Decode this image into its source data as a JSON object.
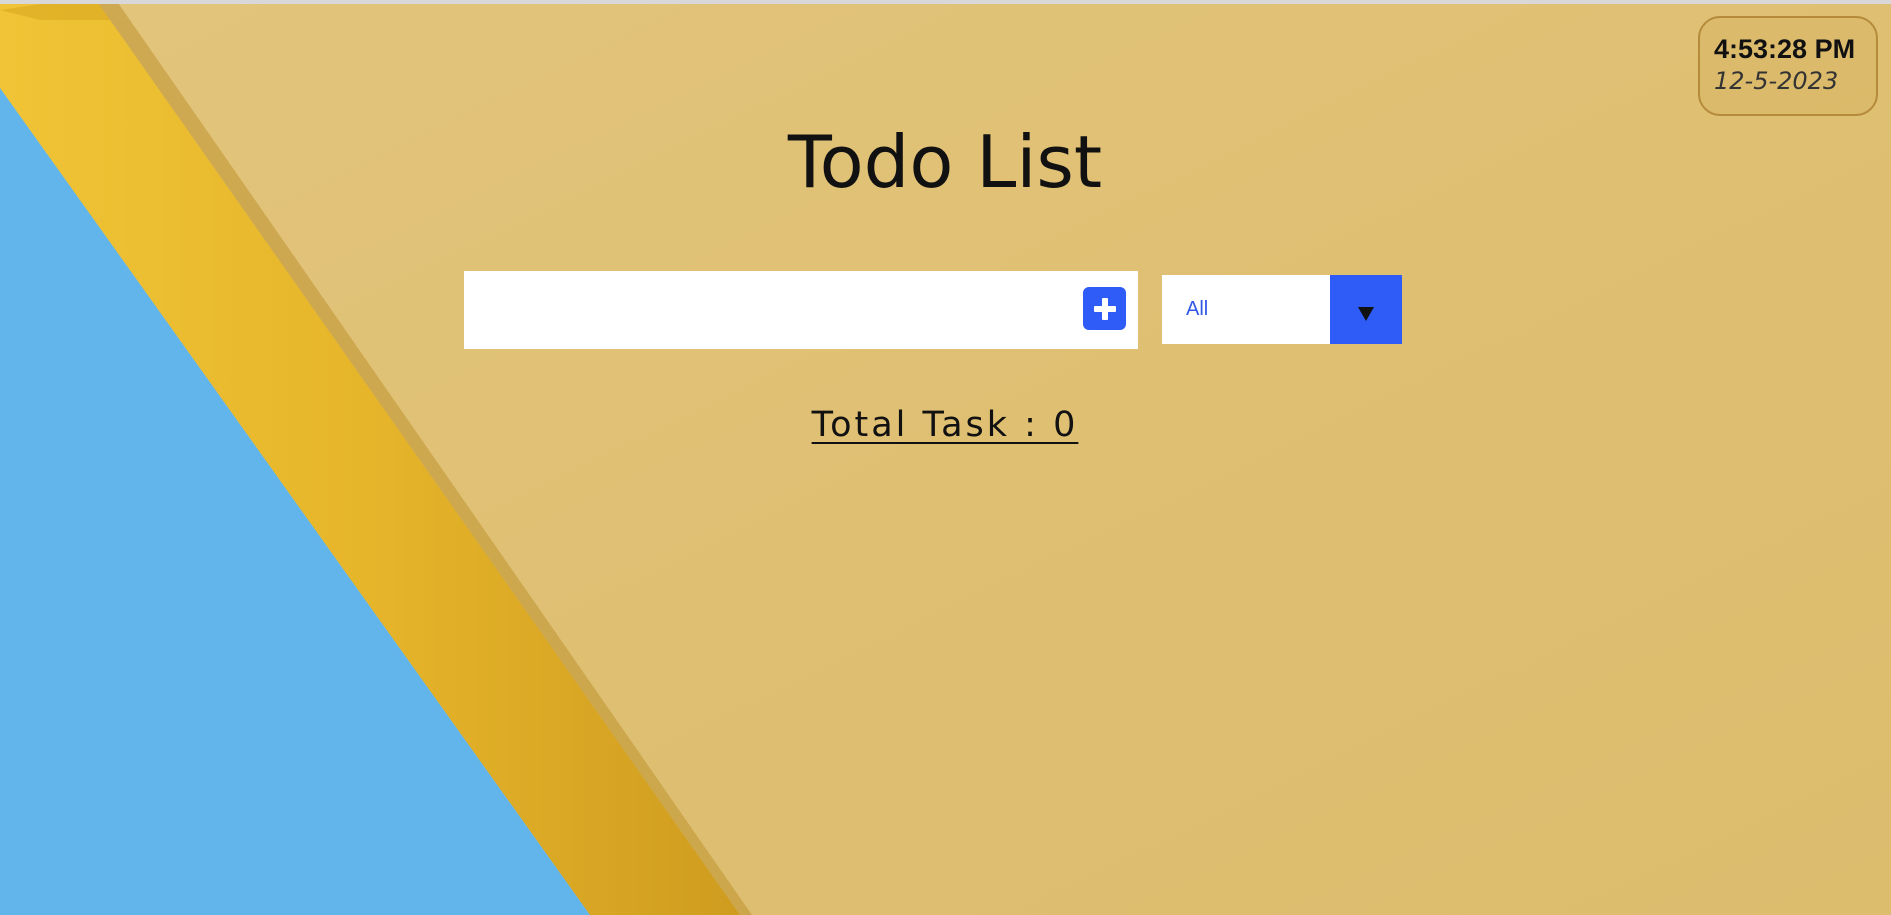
{
  "clock": {
    "time": "4:53:28 PM",
    "date": "12-5-2023"
  },
  "app": {
    "title": "Todo List"
  },
  "task_input": {
    "value": "",
    "placeholder": ""
  },
  "add_button": {
    "icon": "plus-icon"
  },
  "filter": {
    "selected": "All",
    "icon": "triangle-down-icon"
  },
  "summary": {
    "total_label": "Total Task : 0"
  },
  "colors": {
    "accent": "#2f5bf6",
    "paper_background": "#e0c277",
    "pencil_yellow": "#e8b52c",
    "paper_blue": "#62b5ea",
    "clock_border": "#b58a3b"
  }
}
